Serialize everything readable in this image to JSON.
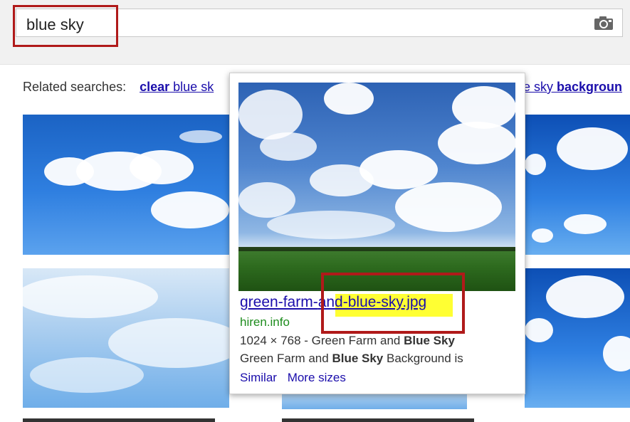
{
  "search": {
    "query": "blue sky"
  },
  "related": {
    "label": "Related searches:",
    "item1_bold": "clear",
    "item1_rest": " blue sk",
    "item2_rest": "e sky ",
    "item2_bold": "backgroun"
  },
  "icons": {
    "camera": "camera-icon"
  },
  "popup": {
    "filename_part1": "green-farm-",
    "filename_part2": "and-blue-sky.jpg",
    "domain": "hiren.info",
    "line1_prefix": "1024 × 768 - Green Farm and ",
    "line1_bold": "Blue Sky",
    "line2_prefix": "Green Farm and ",
    "line2_bold": "Blue Sky",
    "line2_suffix": " Background is",
    "similar": "Similar",
    "more_sizes": "More sizes"
  },
  "colors": {
    "highlight_box": "#b01a1a",
    "link": "#1a0dab",
    "domain": "#1d8c1d",
    "yellow_highlight": "#ffff33"
  }
}
